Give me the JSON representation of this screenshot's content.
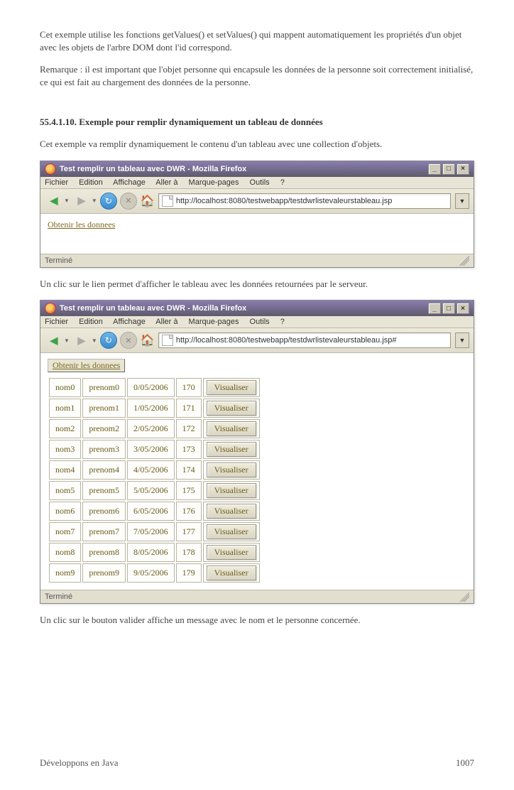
{
  "paragraphs": {
    "p1": "Cet exemple utilise les fonctions getValues() et setValues() qui mappent automatiquement les propriétés d'un objet avec les objets de l'arbre DOM dont l'id correspond.",
    "p2": "Remarque : il est important que l'objet personne qui encapsule les données de la personne soit correctement initialisé, ce qui est fait au chargement des données de la personne.",
    "section_heading": "55.4.1.10. Exemple pour remplir dynamiquement un tableau de données",
    "p3": "Cet exemple va remplir dynamiquement le contenu d'un tableau avec une collection d'objets.",
    "p4": "Un clic sur le lien permet d'afficher le tableau avec les données retournées par le serveur.",
    "p5": "Un clic sur le bouton valider affiche un message avec le nom et le personne concernée."
  },
  "window_common": {
    "title": "Test remplir un tableau avec DWR - Mozilla Firefox",
    "menu": {
      "fichier": "Fichier",
      "edition": "Edition",
      "affichage": "Affichage",
      "aller_a": "Aller à",
      "marque_pages": "Marque-pages",
      "outils": "Outils",
      "aide": "?"
    },
    "status": "Terminé",
    "link_label": "Obtenir les donnees",
    "visualiser": "Visualiser"
  },
  "window1": {
    "url": "http://localhost:8080/testwebapp/testdwrlistevaleurstableau.jsp"
  },
  "window2": {
    "url": "http://localhost:8080/testwebapp/testdwrlistevaleurstableau.jsp#",
    "rows": [
      {
        "nom": "nom0",
        "prenom": "prenom0",
        "date": "0/05/2006",
        "val": "170"
      },
      {
        "nom": "nom1",
        "prenom": "prenom1",
        "date": "1/05/2006",
        "val": "171"
      },
      {
        "nom": "nom2",
        "prenom": "prenom2",
        "date": "2/05/2006",
        "val": "172"
      },
      {
        "nom": "nom3",
        "prenom": "prenom3",
        "date": "3/05/2006",
        "val": "173"
      },
      {
        "nom": "nom4",
        "prenom": "prenom4",
        "date": "4/05/2006",
        "val": "174"
      },
      {
        "nom": "nom5",
        "prenom": "prenom5",
        "date": "5/05/2006",
        "val": "175"
      },
      {
        "nom": "nom6",
        "prenom": "prenom6",
        "date": "6/05/2006",
        "val": "176"
      },
      {
        "nom": "nom7",
        "prenom": "prenom7",
        "date": "7/05/2006",
        "val": "177"
      },
      {
        "nom": "nom8",
        "prenom": "prenom8",
        "date": "8/05/2006",
        "val": "178"
      },
      {
        "nom": "nom9",
        "prenom": "prenom9",
        "date": "9/05/2006",
        "val": "179"
      }
    ]
  },
  "footer": {
    "left": "Développons en Java",
    "right": "1007"
  }
}
